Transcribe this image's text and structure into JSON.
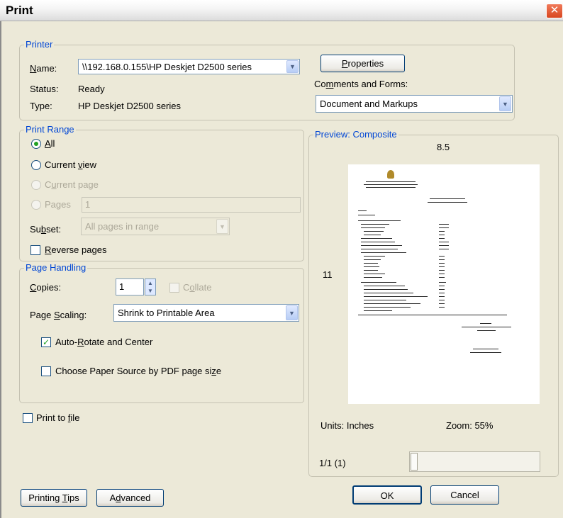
{
  "window": {
    "title": "Print",
    "close_glyph": "✕"
  },
  "printer": {
    "legend": "Printer",
    "name_label": "Name:",
    "name_value": "\\\\192.168.0.155\\HP Deskjet D2500 series",
    "status_label": "Status:",
    "status_value": "Ready",
    "type_label": "Type:",
    "type_value": "HP Deskjet D2500 series",
    "properties_button": "Properties",
    "comments_label": "Comments and Forms:",
    "comments_value": "Document and Markups"
  },
  "print_range": {
    "legend": "Print Range",
    "all": "All",
    "current_view": "Current view",
    "current_page": "Current page",
    "pages": "Pages",
    "pages_value": "1",
    "subset_label": "Subset:",
    "subset_value": "All pages in range",
    "reverse_pages": "Reverse pages"
  },
  "page_handling": {
    "legend": "Page Handling",
    "copies_label": "Copies:",
    "copies_value": "1",
    "collate": "Collate",
    "scaling_label": "Page Scaling:",
    "scaling_value": "Shrink to Printable Area",
    "auto_rotate": "Auto-Rotate and Center",
    "auto_rotate_checked": true,
    "paper_source": "Choose Paper Source by PDF page size"
  },
  "print_to_file": "Print to file",
  "preview": {
    "legend": "Preview: Composite",
    "width_value": "8.5",
    "height_value": "11",
    "units": "Units: Inches",
    "zoom": "Zoom:  55%",
    "page_indicator": "1/1 (1)"
  },
  "buttons": {
    "printing_tips": "Printing Tips",
    "advanced": "Advanced",
    "ok": "OK",
    "cancel": "Cancel"
  },
  "icons": {
    "dropdown": "chevron-down-icon",
    "spinner_up": "arrow-up-icon",
    "spinner_down": "arrow-down-icon",
    "close": "close-icon"
  },
  "colors": {
    "legend_blue": "#0046d5",
    "dialog_bg": "#ece9d8",
    "check_green": "#21a121"
  }
}
